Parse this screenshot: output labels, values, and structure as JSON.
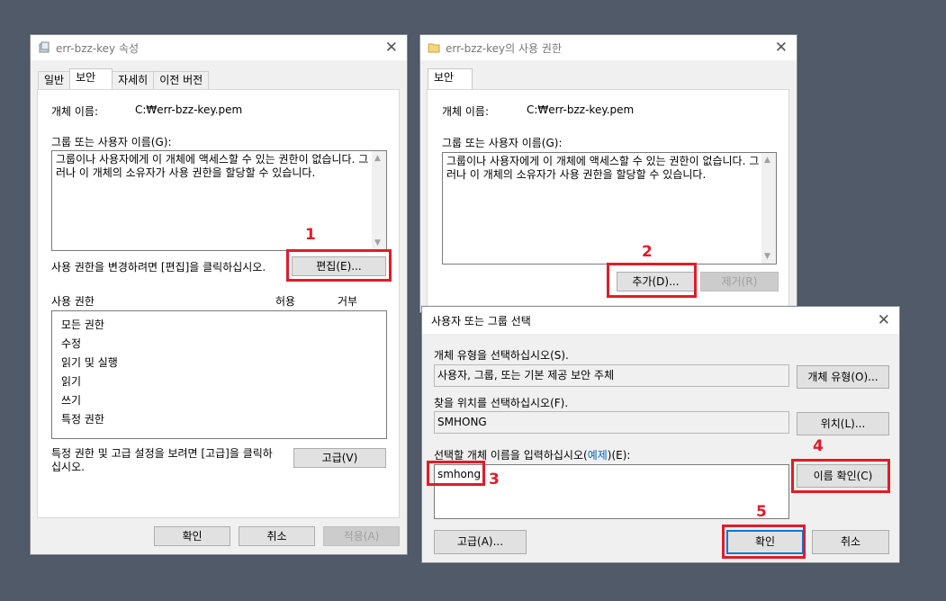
{
  "win1": {
    "title": "err-bzz-key 속성",
    "tabs": [
      "일반",
      "보안",
      "자세히",
      "이전 버전"
    ],
    "object_name_label": "개체 이름:",
    "object_name_value": "C:₩err-bzz-key.pem",
    "group_label": "그룹 또는 사용자 이름(G):",
    "group_text": "그룹이나 사용자에게 이 개체에 액세스할 수 있는 권한이 없습니다. 그러나 이 개체의 소유자가 사용 권한을 할당할 수 있습니다.",
    "change_hint": "사용 권한을 변경하려면 [편집]을 클릭하십시오.",
    "edit_button": "편집(E)...",
    "perm_header": "사용 권한",
    "allow_header": "허용",
    "deny_header": "거부",
    "permissions": [
      "모든 권한",
      "수정",
      "읽기 및 실행",
      "읽기",
      "쓰기",
      "특정 권한"
    ],
    "advanced_hint": "특정 권한 및 고급 설정을 보려면 [고급]을 클릭하십시오.",
    "advanced_button": "고급(V)",
    "ok_button": "확인",
    "cancel_button": "취소",
    "apply_button": "적용(A)"
  },
  "win2": {
    "title": "err-bzz-key의 사용 권한",
    "tab": "보안",
    "object_name_label": "개체 이름:",
    "object_name_value": "C:₩err-bzz-key.pem",
    "group_label": "그룹 또는 사용자 이름(G):",
    "group_text": "그룹이나 사용자에게 이 개체에 액세스할 수 있는 권한이 없습니다. 그러나 이 개체의 소유자가 사용 권한을 할당할 수 있습니다.",
    "add_button": "추가(D)...",
    "remove_button": "제거(R)"
  },
  "win3": {
    "title": "사용자 또는 그룹 선택",
    "object_type_label": "개체 유형을 선택하십시오(S).",
    "object_type_value": "사용자, 그룹, 또는 기본 제공 보안 주체",
    "object_type_button": "개체 유형(O)...",
    "location_label": "찾을 위치를 선택하십시오(F).",
    "location_value": "SMHONG",
    "location_button": "위치(L)...",
    "enter_label_prefix": "선택할 개체 이름을 입력하십시오(",
    "enter_label_link": "예제",
    "enter_label_suffix": ")(E):",
    "names_value": "smhong",
    "check_names_button": "이름 확인(C)",
    "advanced_button": "고급(A)...",
    "ok_button": "확인",
    "cancel_button": "취소"
  },
  "annotations": [
    "1",
    "2",
    "3",
    "4",
    "5"
  ],
  "colors": {
    "annotation_red": "#e21b28",
    "desktop": "#505a68",
    "dialog_bg": "#f0f0f0",
    "focus_blue": "#0078d7"
  }
}
